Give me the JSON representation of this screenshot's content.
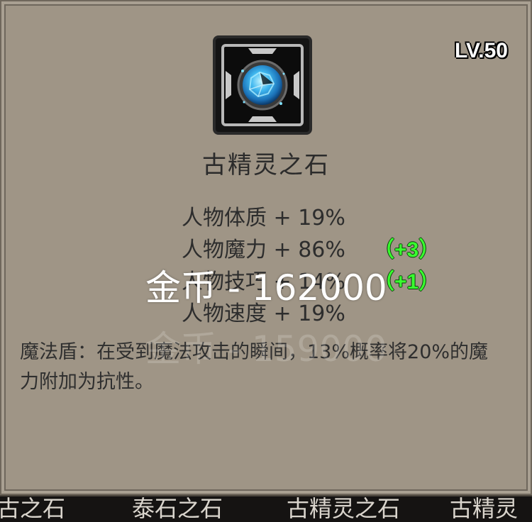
{
  "item": {
    "level": "LV.50",
    "name": "古精灵之石",
    "stats": [
      {
        "label": "人物体质 + 19%",
        "bonus": ""
      },
      {
        "label": "人物魔力 + 86%",
        "bonus": "（+3）"
      },
      {
        "label": "人物技巧 + 14%",
        "bonus": "（+1）"
      },
      {
        "label": "人物速度 + 19%",
        "bonus": ""
      }
    ],
    "description": "魔法盾：在受到魔法攻击的瞬间，13%概率将20%的魔力附加为抗性。",
    "icon": "blue-spirit-stone-icon"
  },
  "price": {
    "current": "金币 - 162000",
    "ghost": "金币 - 159000"
  },
  "bottom_tabs": [
    "古之石",
    "泰石之石",
    "古精灵之石",
    "古精灵"
  ],
  "colors": {
    "panel": "#9f9586",
    "bonus": "#39ff2f",
    "bar": "#151312"
  }
}
